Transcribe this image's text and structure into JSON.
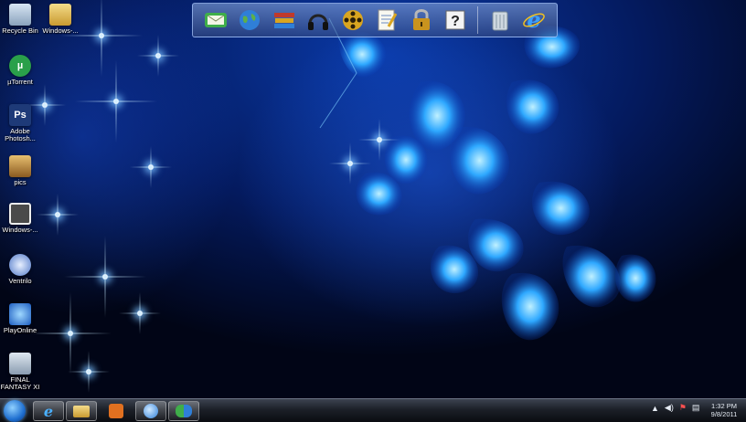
{
  "desktop_icons": [
    {
      "label": "Recycle Bin",
      "icon": "recycle-bin-icon"
    },
    {
      "label": "Windows-...",
      "icon": "folder-icon"
    },
    {
      "label": "µTorrent",
      "icon": "utorrent-icon"
    },
    {
      "label": "Adobe\nPhotosh...",
      "icon": "photoshop-icon"
    },
    {
      "label": "pics",
      "icon": "folder-icon"
    },
    {
      "label": "Windows-...",
      "icon": "windows-app-icon"
    },
    {
      "label": "Ventrilo",
      "icon": "ventrilo-icon"
    },
    {
      "label": "PlayOnline",
      "icon": "playonline-icon"
    },
    {
      "label": "FINAL\nFANTASY XI",
      "icon": "final-fantasy-icon"
    }
  ],
  "dock": {
    "items": [
      "mail-icon",
      "globe-icon",
      "books-icon",
      "headphones-icon",
      "film-reel-icon",
      "notepad-icon",
      "padlock-icon",
      "help-icon",
      "trash-icon",
      "internet-explorer-icon"
    ],
    "colors": {
      "border": "#a8c4ff",
      "mail": "#3fae4a",
      "globe": "#2f7fd8",
      "gold": "#d9a520"
    }
  },
  "taskbar": {
    "start": "windows-start-orb",
    "pinned": [
      "internet-explorer-icon",
      "file-explorer-icon",
      "media-player-icon",
      "network-globe-icon",
      "messenger-icon"
    ],
    "tray": [
      "show-hidden-icons-arrow",
      "volume-icon",
      "action-center-flag-icon",
      "network-icon"
    ],
    "clock_time": "1:32 PM",
    "clock_date": "9/8/2011"
  },
  "colors": {
    "accent": "#1f6fd0",
    "taskbar": "#1c2028",
    "wallpaper_glow": "#3aa0ff"
  }
}
